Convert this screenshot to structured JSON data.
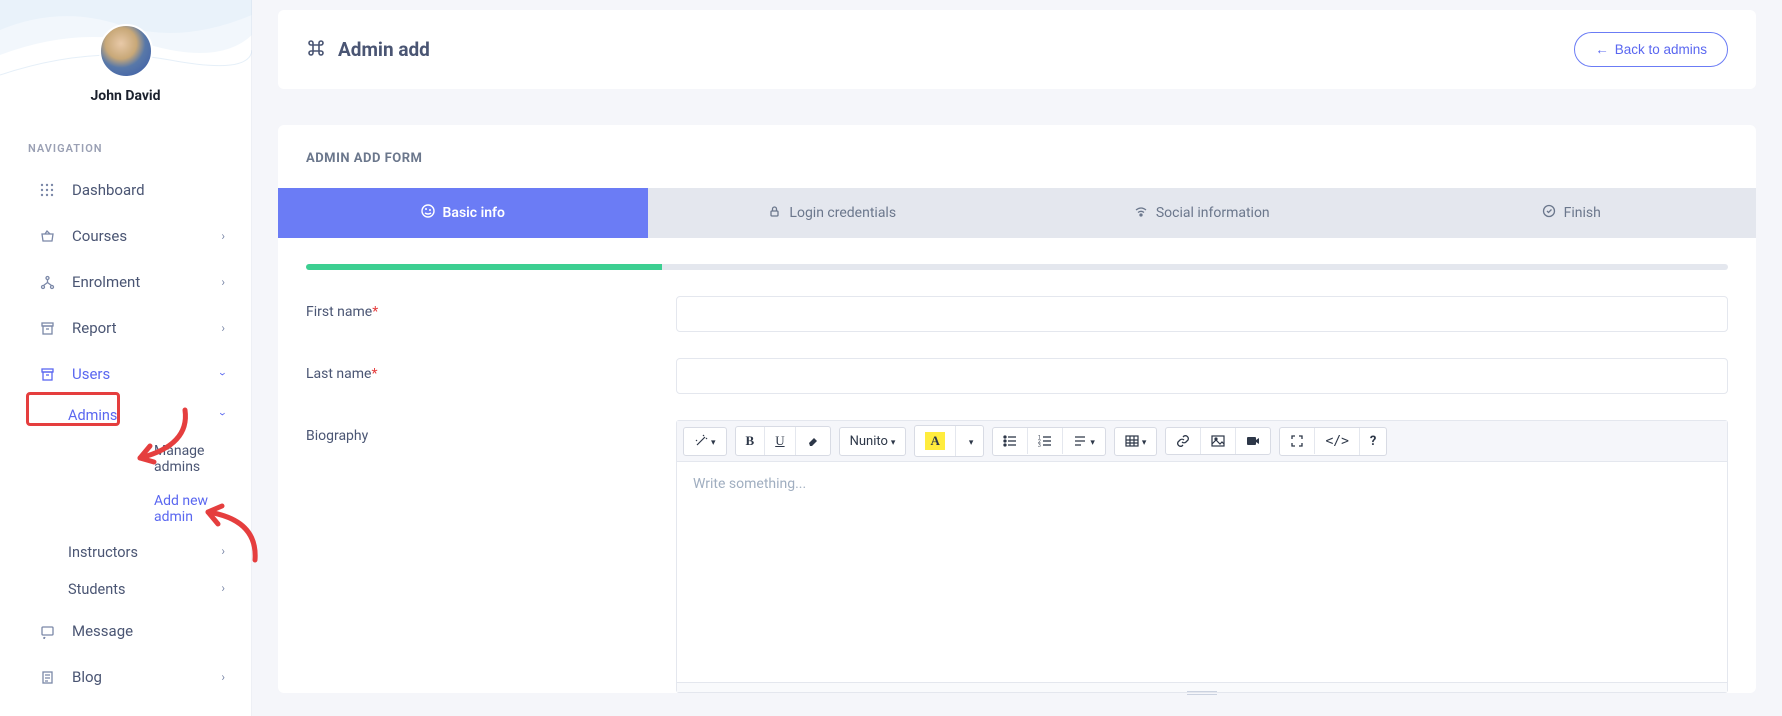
{
  "profile": {
    "name": "John David"
  },
  "sidebar": {
    "heading": "NAVIGATION",
    "dashboard": "Dashboard",
    "courses": "Courses",
    "enrolment": "Enrolment",
    "report": "Report",
    "users": "Users",
    "admins": "Admins",
    "manage_admins": "Manage admins",
    "add_new_admin": "Add new admin",
    "instructors": "Instructors",
    "students": "Students",
    "message": "Message",
    "blog": "Blog"
  },
  "topbar": {
    "title": "Admin add",
    "back": "Back to admins"
  },
  "card": {
    "heading": "ADMIN ADD FORM"
  },
  "tabs": {
    "basic": "Basic info",
    "login": "Login credentials",
    "social": "Social information",
    "finish": "Finish"
  },
  "form": {
    "first_name": "First name",
    "last_name": "Last name",
    "biography": "Biography",
    "required_mark": "*"
  },
  "editor": {
    "font_name": "Nunito",
    "placeholder": "Write something..."
  }
}
